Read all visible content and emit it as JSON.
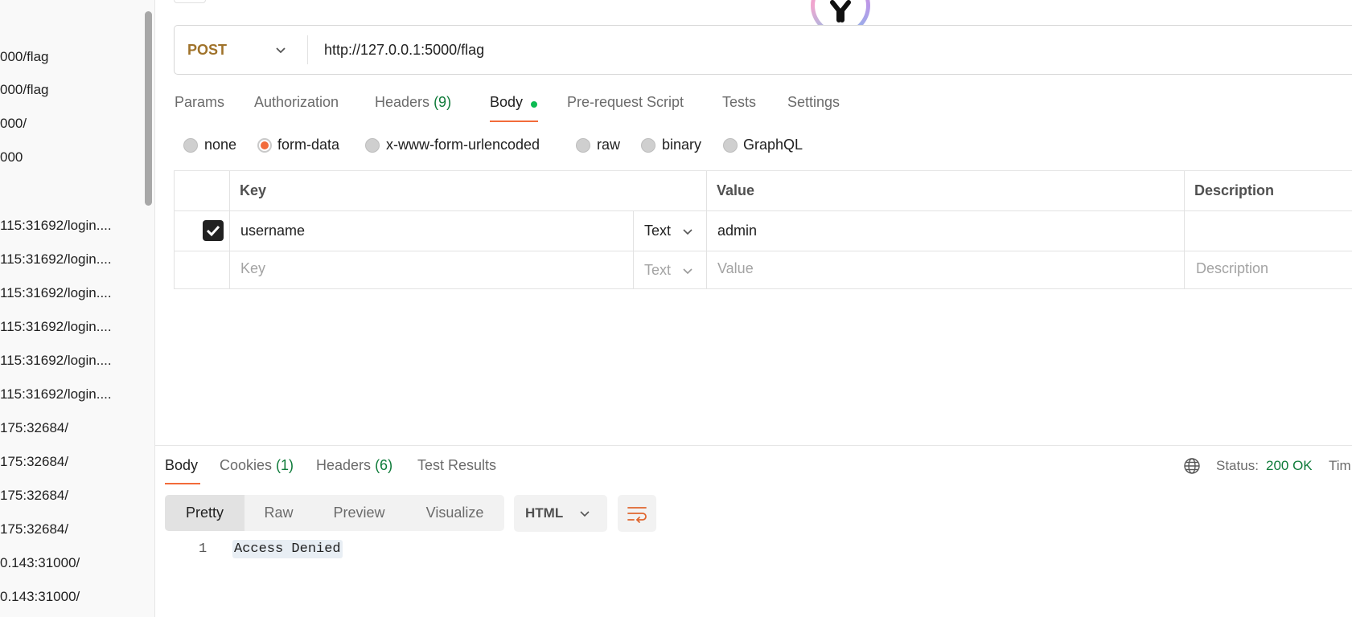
{
  "sidebar": {
    "items": [
      {
        "label": "000/flag"
      },
      {
        "label": "000/flag"
      },
      {
        "label": "000/"
      },
      {
        "label": "000"
      },
      {
        "label": "115:31692/login...."
      },
      {
        "label": "115:31692/login...."
      },
      {
        "label": "115:31692/login...."
      },
      {
        "label": "115:31692/login...."
      },
      {
        "label": "115:31692/login...."
      },
      {
        "label": "115:31692/login...."
      },
      {
        "label": "175:32684/"
      },
      {
        "label": "175:32684/"
      },
      {
        "label": "175:32684/"
      },
      {
        "label": "175:32684/"
      },
      {
        "label": "0.143:31000/"
      },
      {
        "label": "0.143:31000/"
      }
    ]
  },
  "request": {
    "method": "POST",
    "url": "http://127.0.0.1:5000/flag",
    "tabs": [
      {
        "label": "Params"
      },
      {
        "label": "Authorization"
      },
      {
        "label": "Headers",
        "count": "(9)"
      },
      {
        "label": "Body"
      },
      {
        "label": "Pre-request Script"
      },
      {
        "label": "Tests"
      },
      {
        "label": "Settings"
      }
    ],
    "active_tab": "Body",
    "body_types": [
      "none",
      "form-data",
      "x-www-form-urlencoded",
      "raw",
      "binary",
      "GraphQL"
    ],
    "selected_body_type": "form-data",
    "table": {
      "headers": {
        "key": "Key",
        "value": "Value",
        "description": "Description"
      },
      "rows": [
        {
          "checked": true,
          "key": "username",
          "type": "Text",
          "value": "admin",
          "description": ""
        }
      ],
      "placeholder": {
        "key": "Key",
        "type": "Text",
        "value": "Value",
        "description": "Description"
      }
    }
  },
  "response": {
    "tabs": [
      {
        "label": "Body"
      },
      {
        "label": "Cookies",
        "count": "(1)"
      },
      {
        "label": "Headers",
        "count": "(6)"
      },
      {
        "label": "Test Results"
      }
    ],
    "status_label": "Status:",
    "status_value": "200 OK",
    "time_label": "Tim",
    "views": [
      "Pretty",
      "Raw",
      "Preview",
      "Visualize"
    ],
    "active_view": "Pretty",
    "format": "HTML",
    "lines": [
      {
        "number": "1",
        "text": "Access Denied"
      }
    ]
  },
  "colors": {
    "accent": "#f26b3a",
    "method": "#a0732b",
    "status_ok": "#0f7b3a",
    "body_dot": "#0cbb52"
  },
  "icons": [
    "chevron-down-icon",
    "check-icon",
    "globe-icon",
    "wrap-lines-icon",
    "app-logo-icon"
  ]
}
